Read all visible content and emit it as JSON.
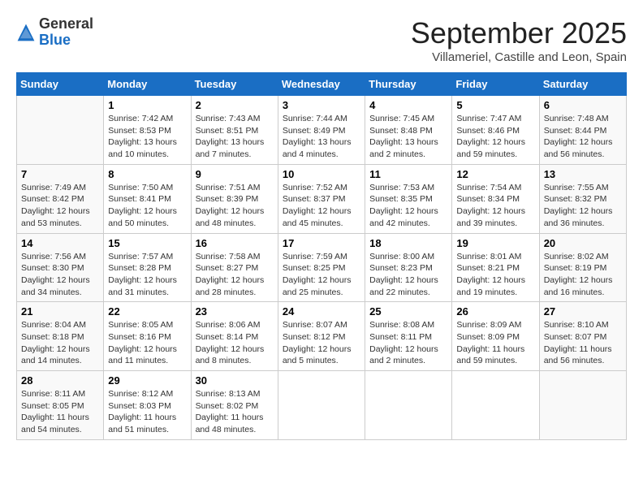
{
  "logo": {
    "general": "General",
    "blue": "Blue"
  },
  "title": "September 2025",
  "location": "Villameriel, Castille and Leon, Spain",
  "days_of_week": [
    "Sunday",
    "Monday",
    "Tuesday",
    "Wednesday",
    "Thursday",
    "Friday",
    "Saturday"
  ],
  "weeks": [
    [
      {
        "day": "",
        "info": ""
      },
      {
        "day": "1",
        "info": "Sunrise: 7:42 AM\nSunset: 8:53 PM\nDaylight: 13 hours\nand 10 minutes."
      },
      {
        "day": "2",
        "info": "Sunrise: 7:43 AM\nSunset: 8:51 PM\nDaylight: 13 hours\nand 7 minutes."
      },
      {
        "day": "3",
        "info": "Sunrise: 7:44 AM\nSunset: 8:49 PM\nDaylight: 13 hours\nand 4 minutes."
      },
      {
        "day": "4",
        "info": "Sunrise: 7:45 AM\nSunset: 8:48 PM\nDaylight: 13 hours\nand 2 minutes."
      },
      {
        "day": "5",
        "info": "Sunrise: 7:47 AM\nSunset: 8:46 PM\nDaylight: 12 hours\nand 59 minutes."
      },
      {
        "day": "6",
        "info": "Sunrise: 7:48 AM\nSunset: 8:44 PM\nDaylight: 12 hours\nand 56 minutes."
      }
    ],
    [
      {
        "day": "7",
        "info": "Sunrise: 7:49 AM\nSunset: 8:42 PM\nDaylight: 12 hours\nand 53 minutes."
      },
      {
        "day": "8",
        "info": "Sunrise: 7:50 AM\nSunset: 8:41 PM\nDaylight: 12 hours\nand 50 minutes."
      },
      {
        "day": "9",
        "info": "Sunrise: 7:51 AM\nSunset: 8:39 PM\nDaylight: 12 hours\nand 48 minutes."
      },
      {
        "day": "10",
        "info": "Sunrise: 7:52 AM\nSunset: 8:37 PM\nDaylight: 12 hours\nand 45 minutes."
      },
      {
        "day": "11",
        "info": "Sunrise: 7:53 AM\nSunset: 8:35 PM\nDaylight: 12 hours\nand 42 minutes."
      },
      {
        "day": "12",
        "info": "Sunrise: 7:54 AM\nSunset: 8:34 PM\nDaylight: 12 hours\nand 39 minutes."
      },
      {
        "day": "13",
        "info": "Sunrise: 7:55 AM\nSunset: 8:32 PM\nDaylight: 12 hours\nand 36 minutes."
      }
    ],
    [
      {
        "day": "14",
        "info": "Sunrise: 7:56 AM\nSunset: 8:30 PM\nDaylight: 12 hours\nand 34 minutes."
      },
      {
        "day": "15",
        "info": "Sunrise: 7:57 AM\nSunset: 8:28 PM\nDaylight: 12 hours\nand 31 minutes."
      },
      {
        "day": "16",
        "info": "Sunrise: 7:58 AM\nSunset: 8:27 PM\nDaylight: 12 hours\nand 28 minutes."
      },
      {
        "day": "17",
        "info": "Sunrise: 7:59 AM\nSunset: 8:25 PM\nDaylight: 12 hours\nand 25 minutes."
      },
      {
        "day": "18",
        "info": "Sunrise: 8:00 AM\nSunset: 8:23 PM\nDaylight: 12 hours\nand 22 minutes."
      },
      {
        "day": "19",
        "info": "Sunrise: 8:01 AM\nSunset: 8:21 PM\nDaylight: 12 hours\nand 19 minutes."
      },
      {
        "day": "20",
        "info": "Sunrise: 8:02 AM\nSunset: 8:19 PM\nDaylight: 12 hours\nand 16 minutes."
      }
    ],
    [
      {
        "day": "21",
        "info": "Sunrise: 8:04 AM\nSunset: 8:18 PM\nDaylight: 12 hours\nand 14 minutes."
      },
      {
        "day": "22",
        "info": "Sunrise: 8:05 AM\nSunset: 8:16 PM\nDaylight: 12 hours\nand 11 minutes."
      },
      {
        "day": "23",
        "info": "Sunrise: 8:06 AM\nSunset: 8:14 PM\nDaylight: 12 hours\nand 8 minutes."
      },
      {
        "day": "24",
        "info": "Sunrise: 8:07 AM\nSunset: 8:12 PM\nDaylight: 12 hours\nand 5 minutes."
      },
      {
        "day": "25",
        "info": "Sunrise: 8:08 AM\nSunset: 8:11 PM\nDaylight: 12 hours\nand 2 minutes."
      },
      {
        "day": "26",
        "info": "Sunrise: 8:09 AM\nSunset: 8:09 PM\nDaylight: 11 hours\nand 59 minutes."
      },
      {
        "day": "27",
        "info": "Sunrise: 8:10 AM\nSunset: 8:07 PM\nDaylight: 11 hours\nand 56 minutes."
      }
    ],
    [
      {
        "day": "28",
        "info": "Sunrise: 8:11 AM\nSunset: 8:05 PM\nDaylight: 11 hours\nand 54 minutes."
      },
      {
        "day": "29",
        "info": "Sunrise: 8:12 AM\nSunset: 8:03 PM\nDaylight: 11 hours\nand 51 minutes."
      },
      {
        "day": "30",
        "info": "Sunrise: 8:13 AM\nSunset: 8:02 PM\nDaylight: 11 hours\nand 48 minutes."
      },
      {
        "day": "",
        "info": ""
      },
      {
        "day": "",
        "info": ""
      },
      {
        "day": "",
        "info": ""
      },
      {
        "day": "",
        "info": ""
      }
    ]
  ]
}
